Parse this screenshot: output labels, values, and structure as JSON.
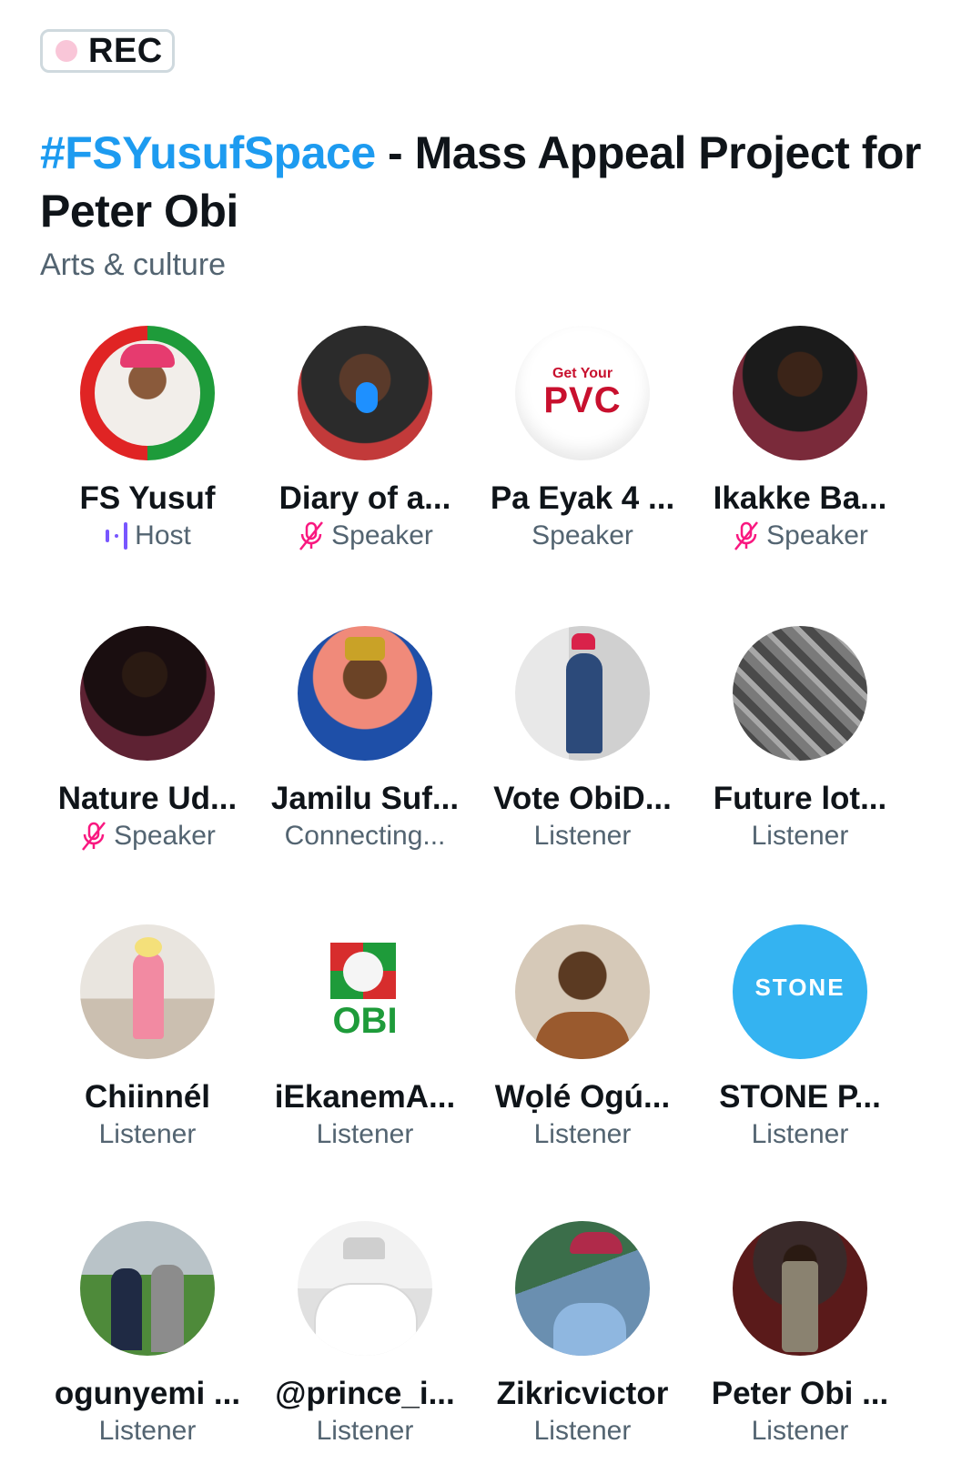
{
  "recording": {
    "label": "REC"
  },
  "space": {
    "hashtag": "#FSYusufSpace",
    "title_rest": " - Mass Appeal Project for Peter Obi",
    "category": "Arts & culture"
  },
  "participants": [
    {
      "name": "FS Yusuf",
      "role": "Host",
      "icon": "host-speaking-icon",
      "avatar": "ring-portrait"
    },
    {
      "name": "Diary of a...",
      "role": "Speaker",
      "icon": "mic-off-icon",
      "avatar": "studio-mic"
    },
    {
      "name": "Pa Eyak 4 ...",
      "role": "Speaker",
      "icon": "",
      "avatar": "get-your-pvc",
      "avatar_text": {
        "line1": "Get Your",
        "line2": "PVC"
      }
    },
    {
      "name": "Ikakke Ba...",
      "role": "Speaker",
      "icon": "mic-off-icon",
      "avatar": "man-portrait"
    },
    {
      "name": "Nature Ud...",
      "role": "Speaker",
      "icon": "mic-off-icon",
      "avatar": "man-portrait-2"
    },
    {
      "name": "Jamilu Suf...",
      "role": "Connecting...",
      "icon": "",
      "avatar": "man-cap"
    },
    {
      "name": "Vote ObiD...",
      "role": "Listener",
      "icon": "",
      "avatar": "man-standing"
    },
    {
      "name": "Future lot...",
      "role": "Listener",
      "icon": "",
      "avatar": "graffiti"
    },
    {
      "name": "Chiinnél",
      "role": "Listener",
      "icon": "",
      "avatar": "woman-standing"
    },
    {
      "name": "iEkanemA...",
      "role": "Listener",
      "icon": "",
      "avatar": "obi-logo",
      "avatar_text": {
        "line1": "OBI"
      }
    },
    {
      "name": "Wọlé Ogú...",
      "role": "Listener",
      "icon": "",
      "avatar": "man-glasses"
    },
    {
      "name": "STONE P...",
      "role": "Listener",
      "icon": "",
      "avatar": "stone-logo",
      "avatar_text": {
        "line1": "STONE"
      }
    },
    {
      "name": "ogunyemi ...",
      "role": "Listener",
      "icon": "",
      "avatar": "field-selfie"
    },
    {
      "name": "@prince_i...",
      "role": "Listener",
      "icon": "",
      "avatar": "man-white-robe"
    },
    {
      "name": "Zikricvictor",
      "role": "Listener",
      "icon": "",
      "avatar": "man-car"
    },
    {
      "name": "Peter Obi ...",
      "role": "Listener",
      "icon": "",
      "avatar": "man-suit"
    }
  ],
  "colors": {
    "accent": "#1d9bf0",
    "mic_off": "#f91880",
    "host_icon": "#7856ff",
    "secondary_text": "#536471"
  }
}
